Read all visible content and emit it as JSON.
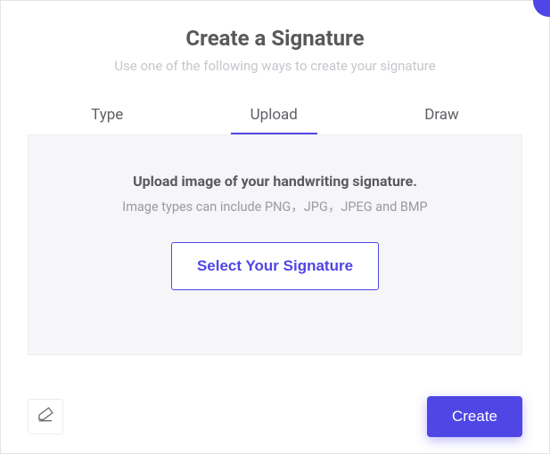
{
  "header": {
    "title": "Create a Signature",
    "subtitle": "Use one of the following ways to create your signature"
  },
  "tabs": {
    "type": "Type",
    "upload": "Upload",
    "draw": "Draw",
    "active": "upload"
  },
  "panel": {
    "headline": "Upload image of your handwriting signature.",
    "subtext": "Image types can include PNG，JPG，JPEG and BMP",
    "select_label": "Select Your Signature"
  },
  "footer": {
    "create_label": "Create"
  },
  "colors": {
    "accent": "#4f46e5"
  }
}
